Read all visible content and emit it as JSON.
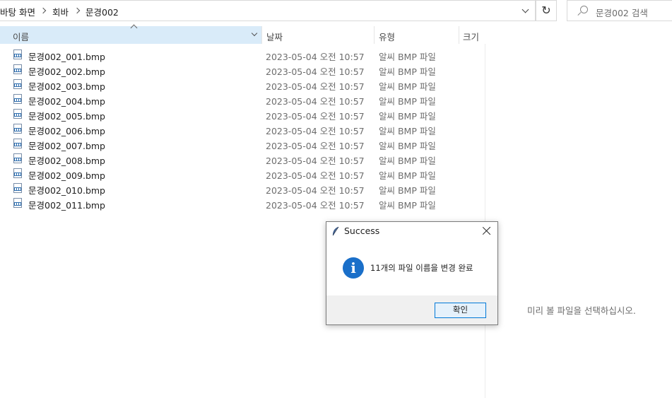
{
  "breadcrumb": [
    "바탕 화면",
    "회바",
    "문경002"
  ],
  "search": {
    "placeholder": "문경002 검색"
  },
  "refresh_glyph": "↻",
  "columns": {
    "name": "이름",
    "date": "날짜",
    "type": "유형",
    "size": "크기"
  },
  "files": [
    {
      "name": "문경002_001.bmp",
      "date": "2023-05-04 오전 10:57",
      "type": "알씨 BMP 파일"
    },
    {
      "name": "문경002_002.bmp",
      "date": "2023-05-04 오전 10:57",
      "type": "알씨 BMP 파일"
    },
    {
      "name": "문경002_003.bmp",
      "date": "2023-05-04 오전 10:57",
      "type": "알씨 BMP 파일"
    },
    {
      "name": "문경002_004.bmp",
      "date": "2023-05-04 오전 10:57",
      "type": "알씨 BMP 파일"
    },
    {
      "name": "문경002_005.bmp",
      "date": "2023-05-04 오전 10:57",
      "type": "알씨 BMP 파일"
    },
    {
      "name": "문경002_006.bmp",
      "date": "2023-05-04 오전 10:57",
      "type": "알씨 BMP 파일"
    },
    {
      "name": "문경002_007.bmp",
      "date": "2023-05-04 오전 10:57",
      "type": "알씨 BMP 파일"
    },
    {
      "name": "문경002_008.bmp",
      "date": "2023-05-04 오전 10:57",
      "type": "알씨 BMP 파일"
    },
    {
      "name": "문경002_009.bmp",
      "date": "2023-05-04 오전 10:57",
      "type": "알씨 BMP 파일"
    },
    {
      "name": "문경002_010.bmp",
      "date": "2023-05-04 오전 10:57",
      "type": "알씨 BMP 파일"
    },
    {
      "name": "문경002_011.bmp",
      "date": "2023-05-04 오전 10:57",
      "type": "알씨 BMP 파일"
    }
  ],
  "preview": {
    "message": "미리 볼 파일을 선택하십시오."
  },
  "dialog": {
    "title": "Success",
    "icon": "info-icon",
    "icon_glyph": "i",
    "message": "11개의 파일 이름을 변경 완료",
    "ok_label": "확인"
  },
  "colors": {
    "accent": "#0078d7",
    "header_selected": "#d9ebf9",
    "info_blue": "#1a6fc9"
  }
}
